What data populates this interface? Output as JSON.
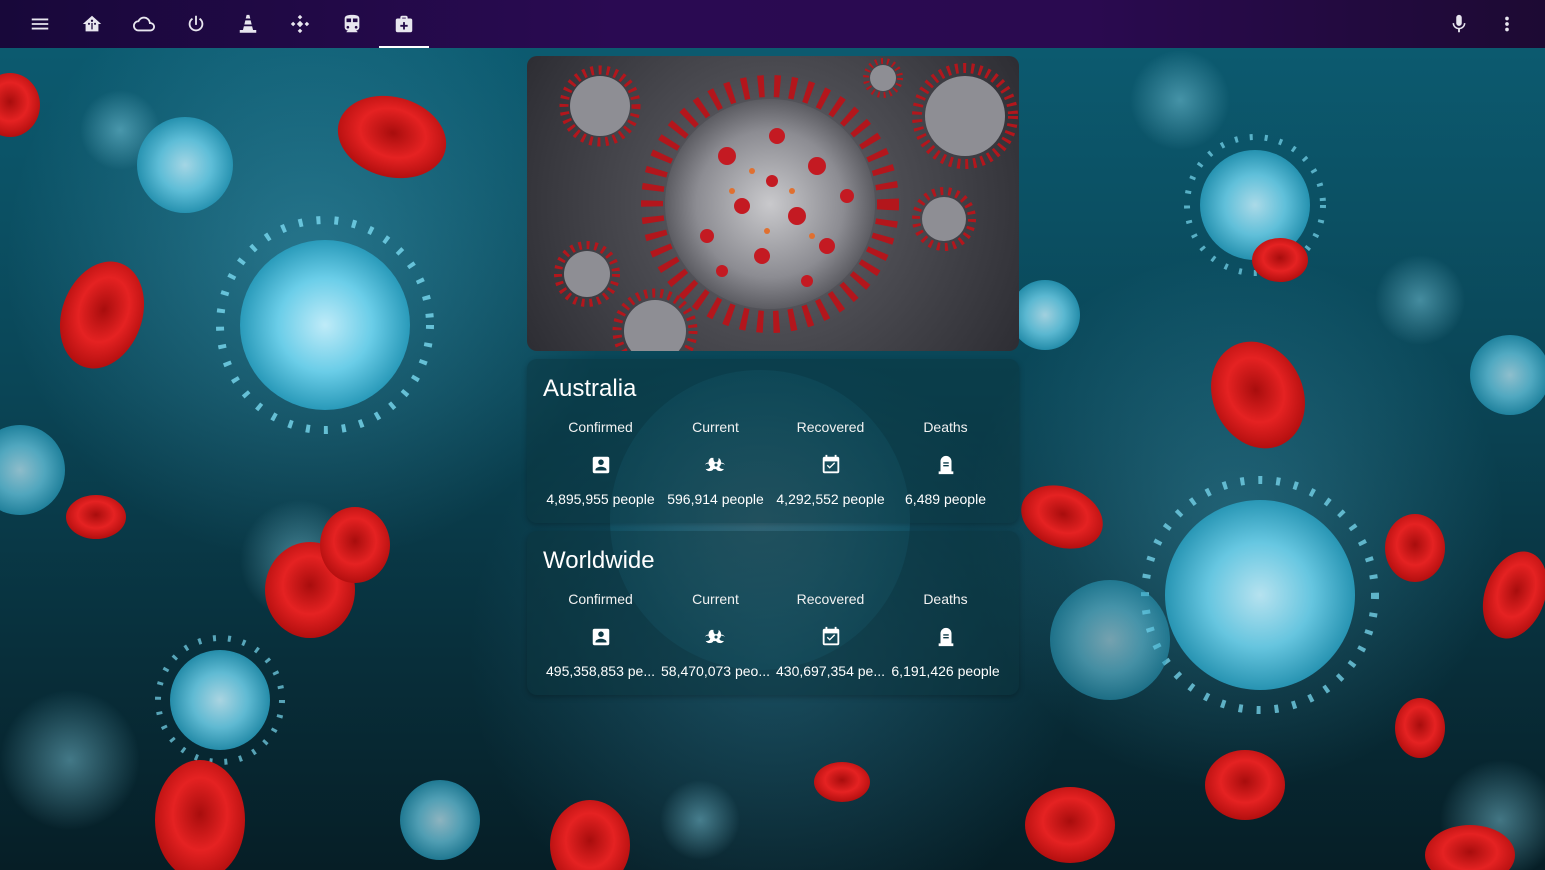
{
  "topbar": {
    "tabs": [
      {
        "icon": "home-assistant-icon",
        "active": false
      },
      {
        "icon": "cloud-icon",
        "active": false
      },
      {
        "icon": "power-icon",
        "active": false
      },
      {
        "icon": "vlc-cone-icon",
        "active": false
      },
      {
        "icon": "kodi-icon",
        "active": false
      },
      {
        "icon": "train-icon",
        "active": false
      },
      {
        "icon": "medical-bag-icon",
        "active": true
      }
    ],
    "accent": "#ffffff",
    "background": "#2a0a52"
  },
  "cards": [
    {
      "title": "Australia",
      "stats": [
        {
          "label": "Confirmed",
          "icon": "account-box-icon",
          "value": "4,895,955 people"
        },
        {
          "label": "Current",
          "icon": "biohazard-icon",
          "value": "596,914 people"
        },
        {
          "label": "Recovered",
          "icon": "calendar-check-icon",
          "value": "4,292,552 people"
        },
        {
          "label": "Deaths",
          "icon": "grave-stone-icon",
          "value": "6,489 people"
        }
      ]
    },
    {
      "title": "Worldwide",
      "stats": [
        {
          "label": "Confirmed",
          "icon": "account-box-icon",
          "value": "495,358,853 pe..."
        },
        {
          "label": "Current",
          "icon": "biohazard-icon",
          "value": "58,470,073 peo..."
        },
        {
          "label": "Recovered",
          "icon": "calendar-check-icon",
          "value": "430,697,354 pe..."
        },
        {
          "label": "Deaths",
          "icon": "grave-stone-icon",
          "value": "6,191,426 people"
        }
      ]
    }
  ]
}
